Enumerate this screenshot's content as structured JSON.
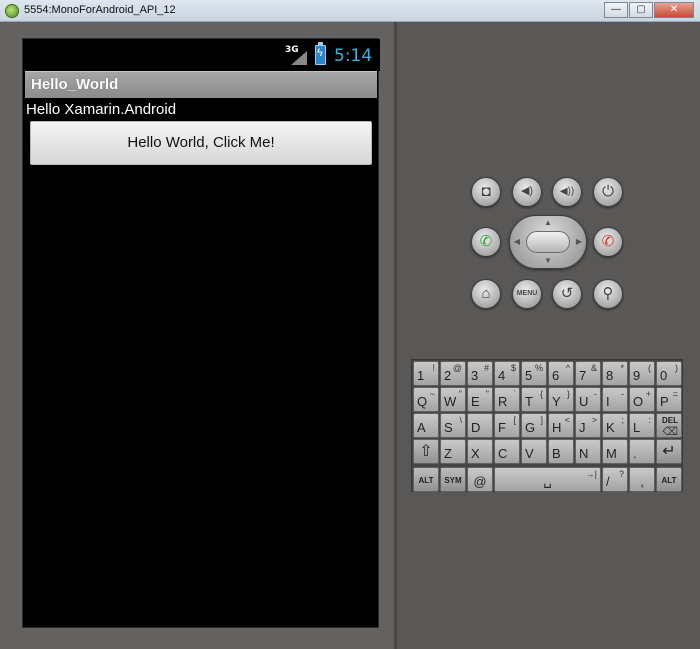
{
  "window": {
    "title": "5554:MonoForAndroid_API_12",
    "minimize_label": "—",
    "maximize_label": "▢",
    "close_label": "✕"
  },
  "status_bar": {
    "network_label": "3G",
    "clock": "5:14",
    "battery_icon": "battery-charging-icon",
    "accent_color": "#33b5e5"
  },
  "app": {
    "action_bar_title": "Hello_World",
    "label_text": "Hello Xamarin.Android",
    "button_label": "Hello World, Click Me!"
  },
  "controls": {
    "camera_glyph": "◘",
    "volume_down_glyph": "◀)",
    "volume_up_glyph": "◀))",
    "power_glyph": "⏻",
    "call_glyph": "✆",
    "end_call_glyph": "✆",
    "home_glyph": "⌂",
    "menu_label": "MENU",
    "back_glyph": "↺",
    "search_glyph": "⚲",
    "dpad_up": "▲",
    "dpad_down": "▼",
    "dpad_left": "◀",
    "dpad_right": "▶"
  },
  "keyboard": {
    "row1": [
      {
        "main": "1",
        "alt": "!"
      },
      {
        "main": "2",
        "alt": "@"
      },
      {
        "main": "3",
        "alt": "#"
      },
      {
        "main": "4",
        "alt": "$"
      },
      {
        "main": "5",
        "alt": "%"
      },
      {
        "main": "6",
        "alt": "^"
      },
      {
        "main": "7",
        "alt": "&"
      },
      {
        "main": "8",
        "alt": "*"
      },
      {
        "main": "9",
        "alt": "("
      },
      {
        "main": "0",
        "alt": ")"
      }
    ],
    "row2": [
      {
        "main": "Q",
        "alt": "~"
      },
      {
        "main": "W",
        "alt": "\""
      },
      {
        "main": "E",
        "alt": "\""
      },
      {
        "main": "R",
        "alt": "`"
      },
      {
        "main": "T",
        "alt": "{"
      },
      {
        "main": "Y",
        "alt": "}"
      },
      {
        "main": "U",
        "alt": "-"
      },
      {
        "main": "I",
        "alt": "-"
      },
      {
        "main": "O",
        "alt": "+"
      },
      {
        "main": "P",
        "alt": "="
      }
    ],
    "row3": [
      {
        "main": "A",
        "alt": ""
      },
      {
        "main": "S",
        "alt": "\\"
      },
      {
        "main": "D",
        "alt": ""
      },
      {
        "main": "F",
        "alt": "["
      },
      {
        "main": "G",
        "alt": "]"
      },
      {
        "main": "H",
        "alt": "<"
      },
      {
        "main": "J",
        "alt": ">"
      },
      {
        "main": "K",
        "alt": ";"
      },
      {
        "main": "L",
        "alt": ":"
      },
      {
        "main": "DEL",
        "alt": "⌫"
      }
    ],
    "row4": [
      {
        "main": "⇧",
        "alt": ""
      },
      {
        "main": "Z",
        "alt": ""
      },
      {
        "main": "X",
        "alt": ""
      },
      {
        "main": "C",
        "alt": ""
      },
      {
        "main": "V",
        "alt": ""
      },
      {
        "main": "B",
        "alt": ""
      },
      {
        "main": "N",
        "alt": ""
      },
      {
        "main": "M",
        "alt": ""
      },
      {
        "main": ".",
        "alt": ""
      },
      {
        "main": "↵",
        "alt": ""
      }
    ],
    "row5": {
      "alt_left": "ALT",
      "sym": "SYM",
      "at": "@",
      "space": "␣",
      "space_alt": "→|",
      "slash": "/",
      "question": "?",
      "comma": ",",
      "alt_right": "ALT"
    }
  }
}
